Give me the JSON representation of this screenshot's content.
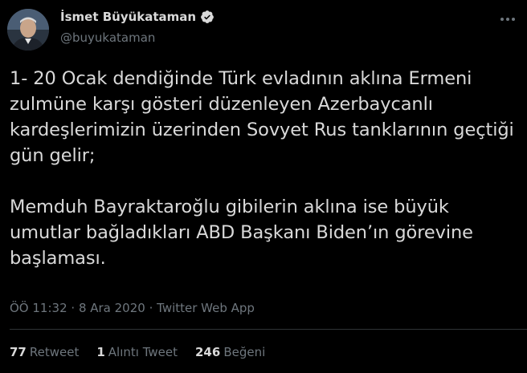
{
  "user": {
    "display_name": "İsmet Büyükataman",
    "handle": "@buyukataman"
  },
  "tweet": {
    "text": "1- 20 Ocak dendiğinde Türk evladının aklına Ermeni zulmüne karşı gösteri düzenleyen Azerbaycanlı kardeşlerimizin üzerinden Sovyet Rus tanklarının geçtiği gün gelir;\n\nMemduh Bayraktaroğlu gibilerin aklına ise büyük umutlar bağladıkları ABD Başkanı Biden’ın görevine başlaması.",
    "time": "ÖÖ 11:32",
    "date": "8 Ara 2020",
    "source": "Twitter Web App"
  },
  "stats": {
    "retweets": "77",
    "retweets_label": "Retweet",
    "quotes": "1",
    "quotes_label": "Alıntı Tweet",
    "likes": "246",
    "likes_label": "Beğeni"
  },
  "colors": {
    "background": "#000000",
    "text": "#d9d9d9",
    "secondary": "#6e767d",
    "divider": "#2f3336",
    "verified_badge": "#d9d9d9"
  }
}
